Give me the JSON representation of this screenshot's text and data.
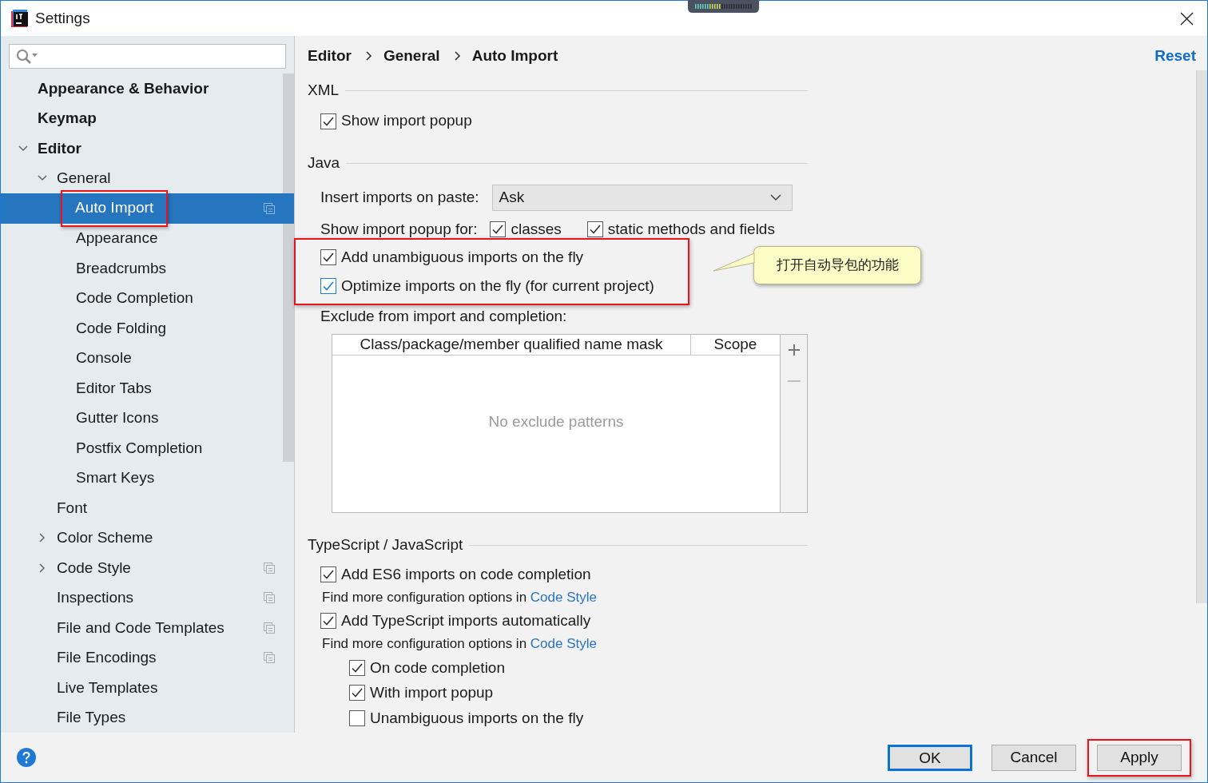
{
  "window": {
    "title": "Settings"
  },
  "sidebar": {
    "tree": [
      {
        "label": "Appearance & Behavior",
        "selected": false,
        "project_level": false,
        "highlighted": false
      },
      {
        "label": "Keymap",
        "selected": false,
        "project_level": false,
        "highlighted": false
      },
      {
        "label": "Editor",
        "selected": false,
        "project_level": false,
        "highlighted": false,
        "expanded": true,
        "children": [
          {
            "label": "General",
            "selected": false,
            "project_level": false,
            "highlighted": false,
            "expanded": true,
            "children": [
              {
                "label": "Auto Import",
                "selected": true,
                "project_level": true,
                "highlighted": true
              },
              {
                "label": "Appearance",
                "selected": false,
                "project_level": false,
                "highlighted": false
              },
              {
                "label": "Breadcrumbs",
                "selected": false,
                "project_level": false,
                "highlighted": false
              },
              {
                "label": "Code Completion",
                "selected": false,
                "project_level": false,
                "highlighted": false
              },
              {
                "label": "Code Folding",
                "selected": false,
                "project_level": false,
                "highlighted": false
              },
              {
                "label": "Console",
                "selected": false,
                "project_level": false,
                "highlighted": false
              },
              {
                "label": "Editor Tabs",
                "selected": false,
                "project_level": false,
                "highlighted": false
              },
              {
                "label": "Gutter Icons",
                "selected": false,
                "project_level": false,
                "highlighted": false
              },
              {
                "label": "Postfix Completion",
                "selected": false,
                "project_level": false,
                "highlighted": false
              },
              {
                "label": "Smart Keys",
                "selected": false,
                "project_level": false,
                "highlighted": false
              }
            ]
          },
          {
            "label": "Font",
            "selected": false,
            "project_level": false,
            "highlighted": false
          },
          {
            "label": "Color Scheme",
            "selected": false,
            "project_level": false,
            "highlighted": false,
            "expanded": false
          },
          {
            "label": "Code Style",
            "selected": false,
            "project_level": true,
            "highlighted": false,
            "expanded": false
          },
          {
            "label": "Inspections",
            "selected": false,
            "project_level": true,
            "highlighted": false
          },
          {
            "label": "File and Code Templates",
            "selected": false,
            "project_level": true,
            "highlighted": false
          },
          {
            "label": "File Encodings",
            "selected": false,
            "project_level": true,
            "highlighted": false
          },
          {
            "label": "Live Templates",
            "selected": false,
            "project_level": false,
            "highlighted": false
          },
          {
            "label": "File Types",
            "selected": false,
            "project_level": false,
            "highlighted": false
          }
        ]
      }
    ]
  },
  "header": {
    "breadcrumb": [
      "Editor",
      "General",
      "Auto Import"
    ],
    "reset": "Reset"
  },
  "xml": {
    "title": "XML",
    "options": [
      {
        "label": "Show import popup",
        "checked": true,
        "focused": false
      }
    ]
  },
  "java": {
    "title": "Java",
    "insert_imports": {
      "label": "Insert imports on paste:",
      "value": "Ask"
    },
    "popup_for": {
      "label": "Show import popup for:",
      "options": [
        {
          "label": "classes",
          "checked": true
        },
        {
          "label": "static methods and fields",
          "checked": true
        }
      ]
    },
    "options": [
      {
        "label": "Add unambiguous imports on the fly",
        "checked": true,
        "focused": false
      },
      {
        "label": "Optimize imports on the fly (for current project)",
        "checked": true,
        "focused": true
      }
    ],
    "options_highlighted": true,
    "callout": {
      "text": "打开自动导包的功能"
    },
    "exclude": {
      "label": "Exclude from import and completion:",
      "columns": [
        "Class/package/member qualified name mask",
        "Scope"
      ],
      "empty_text": "No exclude patterns"
    }
  },
  "typescript": {
    "title": "TypeScript / JavaScript",
    "items": [
      {
        "label": "Add ES6 imports on code completion",
        "checked": true,
        "hint": {
          "text": "Find more configuration options in",
          "link": "Code Style"
        }
      },
      {
        "label": "Add TypeScript imports automatically",
        "checked": true,
        "hint": {
          "text": "Find more configuration options in",
          "link": "Code Style"
        },
        "children": [
          {
            "label": "On code completion",
            "checked": true
          },
          {
            "label": "With import popup",
            "checked": true
          },
          {
            "label": "Unambiguous imports on the fly",
            "checked": false
          }
        ]
      }
    ]
  },
  "footer": {
    "buttons": [
      {
        "label": "OK",
        "default": true,
        "highlighted": false
      },
      {
        "label": "Cancel",
        "default": false,
        "highlighted": false
      },
      {
        "label": "Apply",
        "default": false,
        "highlighted": true
      }
    ]
  }
}
